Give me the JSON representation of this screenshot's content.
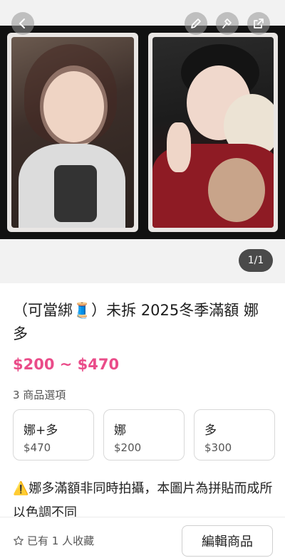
{
  "gallery": {
    "counter": "1/1",
    "colors": {
      "strip": "#111111",
      "counter_bg": "#4a4a4a"
    }
  },
  "product": {
    "title": "（可當綁🧵）未拆 2025冬季滿額 娜多",
    "price": "$200 ~ $470",
    "price_color": "#ea4c89",
    "options_count": "3 商品選項",
    "options": [
      {
        "name": "娜+多",
        "price": "$470"
      },
      {
        "name": "娜",
        "price": "$200"
      },
      {
        "name": "多",
        "price": "$300"
      }
    ],
    "description": "⚠️娜多滿額非同時拍攝，本圖片為拼貼而成所以色調不同"
  },
  "bottom_bar": {
    "favorites": "已有 1 人收藏",
    "edit_button": "編輯商品"
  },
  "icons": [
    "back-icon",
    "pencil-icon",
    "hammer-icon",
    "share-icon",
    "star-icon"
  ]
}
